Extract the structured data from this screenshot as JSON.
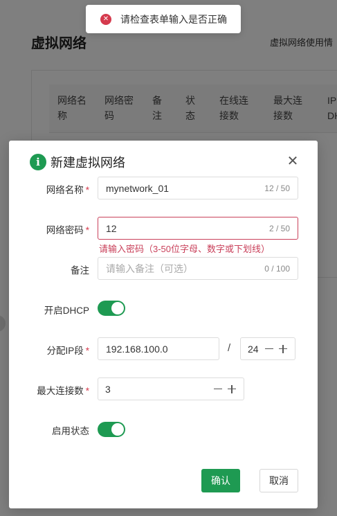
{
  "page": {
    "title": "虚拟网络",
    "note": "虚拟网络使用情",
    "table_headers": [
      "网络名称",
      "网络密码",
      "备注",
      "状态",
      "在线连接数",
      "最大连接数",
      "IP DH"
    ]
  },
  "toast": {
    "icon": "error-icon",
    "message": "请检查表单输入是否正确",
    "color": "#d53a4d"
  },
  "dialog": {
    "title": "新建虚拟网络",
    "title_icon": "info-icon",
    "accent_color": "#1e9a52",
    "fields": {
      "network_name": {
        "label": "网络名称",
        "required": "*",
        "value": "mynetwork_01",
        "count": "12 / 50"
      },
      "network_password": {
        "label": "网络密码",
        "required": "*",
        "value": "12",
        "count": "2 / 50",
        "error": "请输入密码（3-50位字母、数字或下划线）"
      },
      "remark": {
        "label": "备注",
        "placeholder": "请输入备注（可选）",
        "count": "0 / 100"
      },
      "dhcp": {
        "label": "开启DHCP",
        "on": true
      },
      "ip_segment": {
        "label": "分配IP段",
        "required": "*",
        "value": "192.168.100.0",
        "separator": "/",
        "prefix": "24"
      },
      "max_connections": {
        "label": "最大连接数",
        "required": "*",
        "value": "3"
      },
      "enabled": {
        "label": "启用状态",
        "on": true
      }
    },
    "confirm_label": "确认",
    "cancel_label": "取消"
  }
}
